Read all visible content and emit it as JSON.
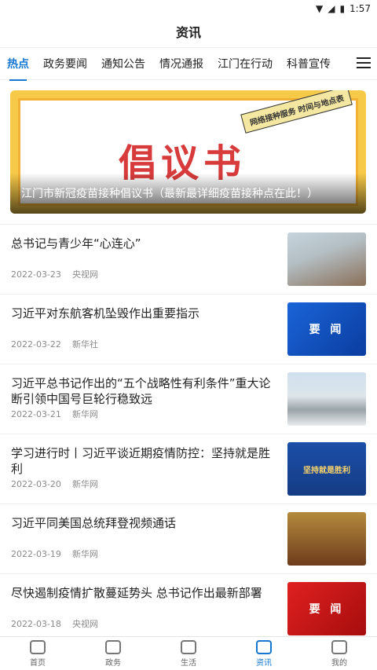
{
  "status": {
    "time": "1:57"
  },
  "header": {
    "title": "资讯"
  },
  "tabs": [
    {
      "label": "热点",
      "active": true
    },
    {
      "label": "政务要闻"
    },
    {
      "label": "通知公告"
    },
    {
      "label": "情况通报"
    },
    {
      "label": "江门在行动"
    },
    {
      "label": "科普宣传"
    }
  ],
  "banner": {
    "headline": "倡议书",
    "tag": "网络接种服务 时间与地点表",
    "caption": "江门市新冠疫苗接种倡议书（最新最详细疫苗接种点在此！）"
  },
  "news": [
    {
      "title": "总书记与青少年“心连心”",
      "date": "2022-03-23",
      "source": "央视网",
      "thumb": "photo1",
      "thumb_text": ""
    },
    {
      "title": "习近平对东航客机坠毁作出重要指示",
      "date": "2022-03-22",
      "source": "新华社",
      "thumb": "blue",
      "thumb_text": "要 闻"
    },
    {
      "title": "习近平总书记作出的“五个战略性有利条件”重大论断引领中国号巨轮行稳致远",
      "date": "2022-03-21",
      "source": "新华网",
      "thumb": "photo2",
      "thumb_text": ""
    },
    {
      "title": "学习进行时丨习近平谈近期疫情防控：坚持就是胜利",
      "date": "2022-03-20",
      "source": "新华网",
      "thumb": "photo3",
      "thumb_text": "坚持就是胜利"
    },
    {
      "title": "习近平同美国总统拜登视频通话",
      "date": "2022-03-19",
      "source": "新华网",
      "thumb": "photo4",
      "thumb_text": ""
    },
    {
      "title": "尽快遏制疫情扩散蔓延势头 总书记作出最新部署",
      "date": "2022-03-18",
      "source": "央视网",
      "thumb": "red",
      "thumb_text": "要 闻"
    }
  ],
  "bottom_nav": [
    {
      "label": "首页",
      "icon": "home-icon"
    },
    {
      "label": "政务",
      "icon": "gov-icon"
    },
    {
      "label": "生活",
      "icon": "heart-icon"
    },
    {
      "label": "资讯",
      "icon": "news-icon",
      "active": true
    },
    {
      "label": "我的",
      "icon": "user-icon"
    }
  ]
}
